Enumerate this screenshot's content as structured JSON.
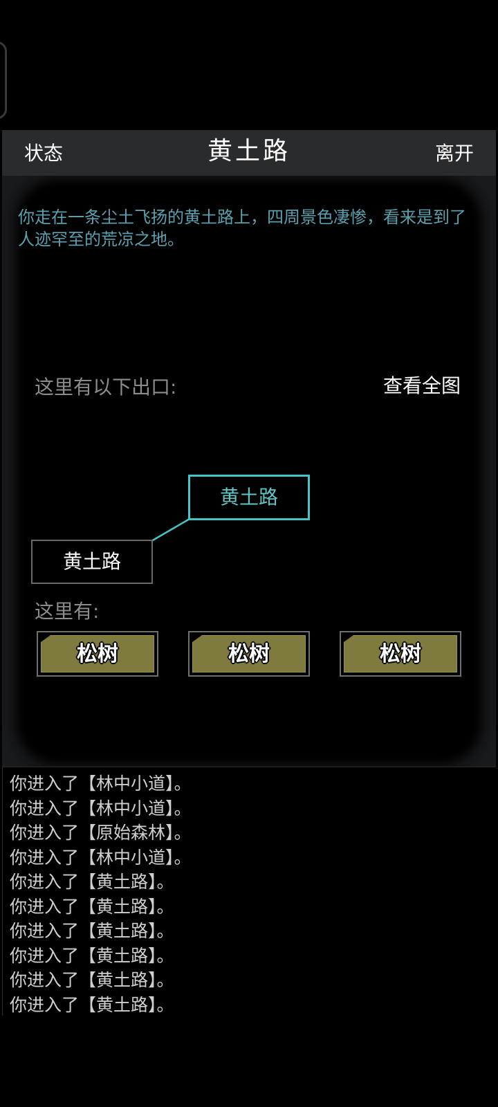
{
  "header": {
    "left_label": "状态",
    "title": "黄土路",
    "right_label": "离开"
  },
  "room": {
    "description": "你走在一条尘土飞扬的黄土路上，四周景色凄惨，看来是到了人迹罕至的荒凉之地。",
    "exits_label": "这里有以下出口:",
    "view_map_label": "查看全图",
    "current_node": "黄土路",
    "exit_node": "黄土路",
    "here_label": "这里有:",
    "objects": [
      "松树",
      "松树",
      "松树"
    ]
  },
  "log": [
    "你进入了【林中小道】。",
    "你进入了【林中小道】。",
    "你进入了【原始森林】。",
    "你进入了【林中小道】。",
    "你进入了【黄土路】。",
    "你进入了【黄土路】。",
    "你进入了【黄土路】。",
    "你进入了【黄土路】。",
    "你进入了【黄土路】。",
    "你进入了【黄土路】。"
  ],
  "colors": {
    "accent_cyan": "#46c5c7",
    "description_text": "#5ba0ae",
    "object_fill": "#7f7a3e"
  }
}
